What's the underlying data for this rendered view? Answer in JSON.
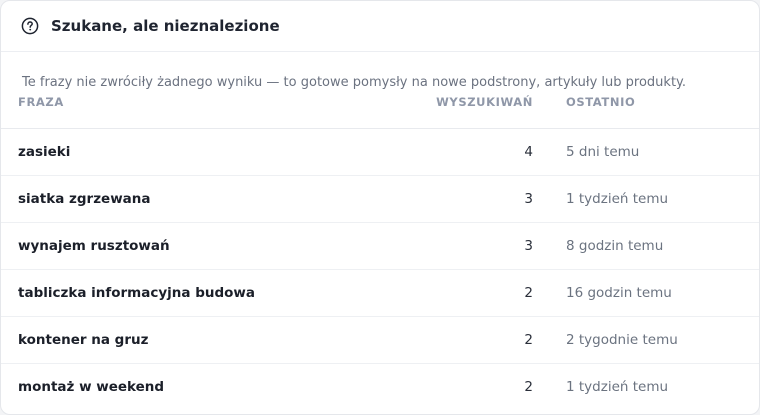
{
  "panel": {
    "title": "Szukane, ale nieznalezione",
    "icon": "question-circle-icon",
    "description": "Te frazy nie zwróciły żadnego wyniku — to gotowe pomysły na nowe podstrony, artykuły lub produkty."
  },
  "table": {
    "headers": {
      "phrase": "FRAZA",
      "searches": "WYSZUKIWAŃ",
      "last": "OSTATNIO"
    },
    "rows": [
      {
        "phrase": "zasieki",
        "searches": "4",
        "last": "5 dni temu"
      },
      {
        "phrase": "siatka zgrzewana",
        "searches": "3",
        "last": "1 tydzień temu"
      },
      {
        "phrase": "wynajem rusztowań",
        "searches": "3",
        "last": "8 godzin temu"
      },
      {
        "phrase": "tabliczka informacyjna budowa",
        "searches": "2",
        "last": "16 godzin temu"
      },
      {
        "phrase": "kontener na gruz",
        "searches": "2",
        "last": "2 tygodnie temu"
      },
      {
        "phrase": "montaż w weekend",
        "searches": "2",
        "last": "1 tydzień temu"
      }
    ]
  }
}
